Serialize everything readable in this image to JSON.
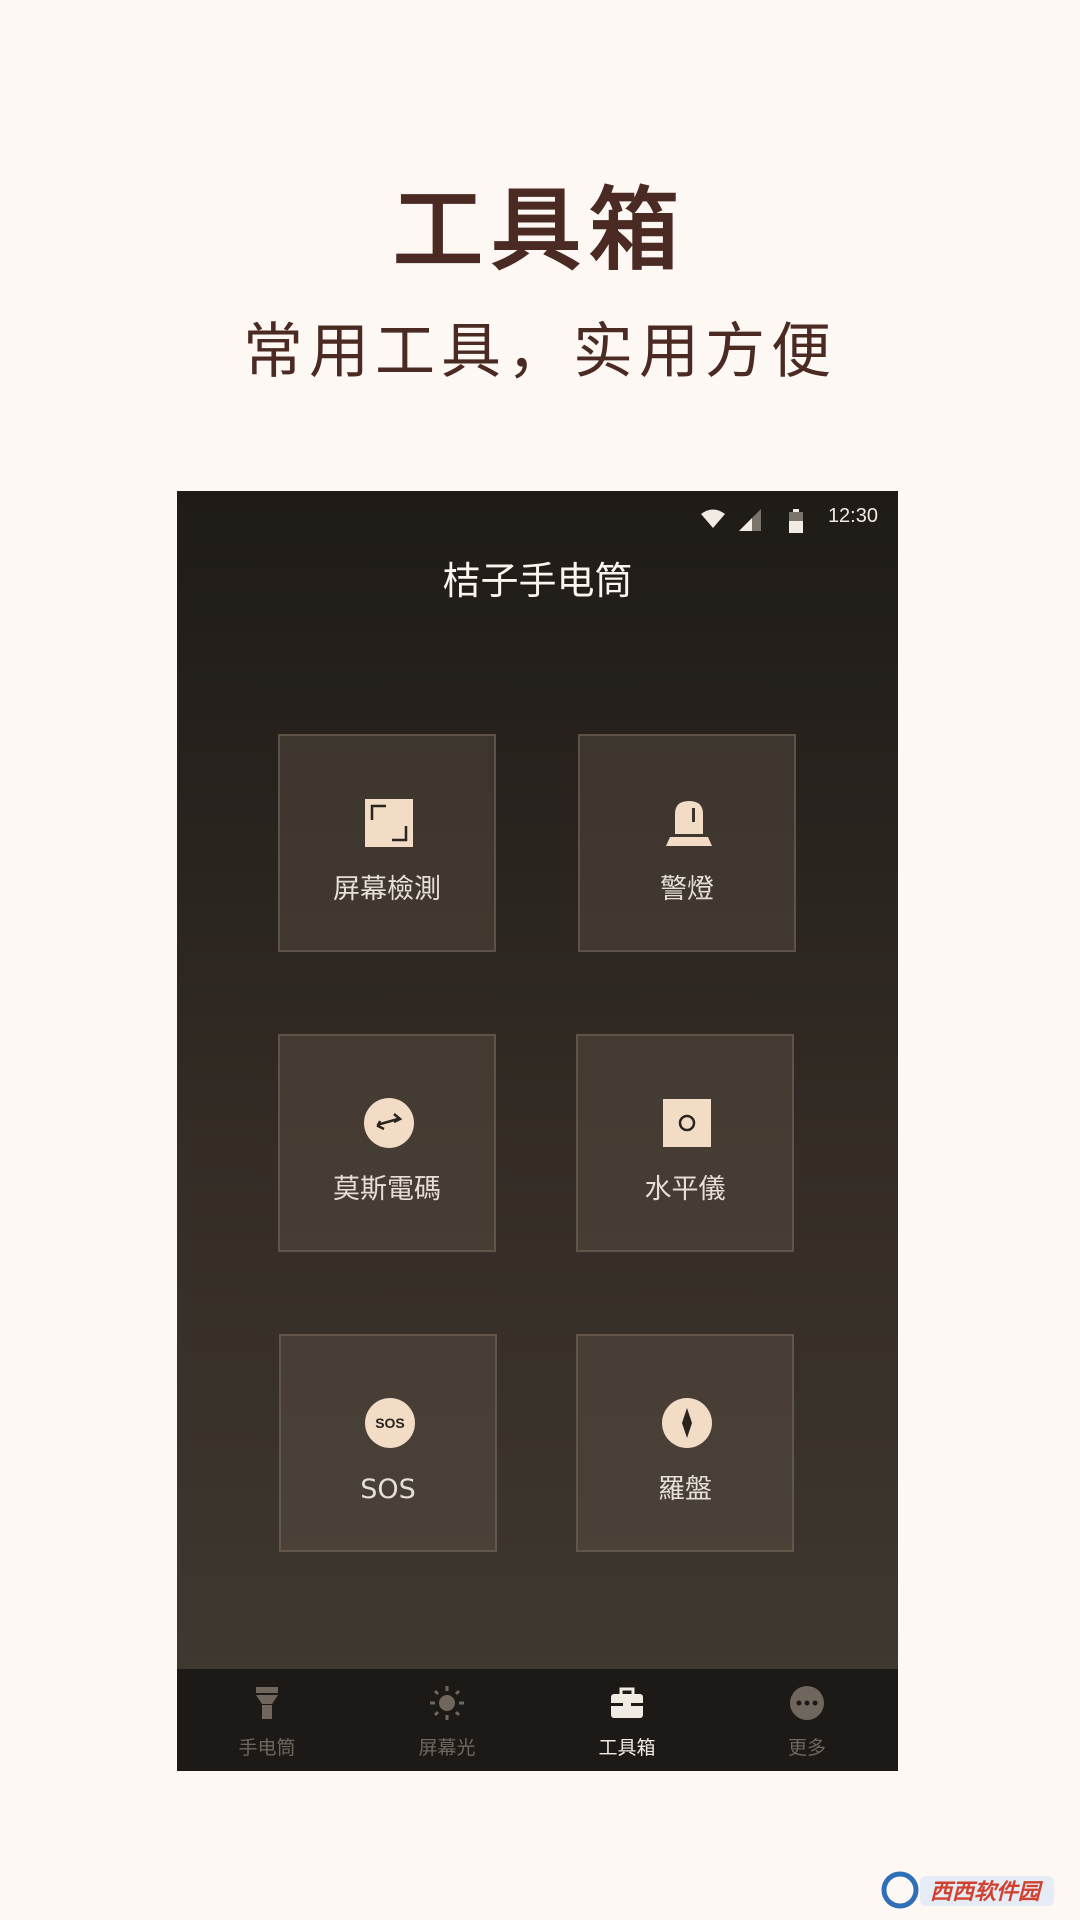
{
  "promo": {
    "title": "工具箱",
    "subtitle": "常用工具，实用方便"
  },
  "status_bar": {
    "time": "12:30",
    "icons": [
      "wifi-icon",
      "cellular-signal-icon",
      "battery-icon"
    ]
  },
  "app": {
    "title": "桔子手电筒"
  },
  "tools": [
    {
      "label": "屏幕檢測",
      "icon": "screen-test-icon"
    },
    {
      "label": "警燈",
      "icon": "warning-light-icon"
    },
    {
      "label": "莫斯電碼",
      "icon": "morse-code-icon"
    },
    {
      "label": "水平儀",
      "icon": "level-icon"
    },
    {
      "label": "SOS",
      "icon": "sos-icon",
      "icon_text": "SOS"
    },
    {
      "label": "羅盤",
      "icon": "compass-icon"
    }
  ],
  "tabs": [
    {
      "label": "手电筒",
      "icon": "flashlight-icon",
      "active": false
    },
    {
      "label": "屏幕光",
      "icon": "screen-light-icon",
      "active": false
    },
    {
      "label": "工具箱",
      "icon": "toolbox-icon",
      "active": true
    },
    {
      "label": "更多",
      "icon": "more-icon",
      "active": false
    }
  ],
  "colors": {
    "page_background": "#fdf8f3",
    "promo_text": "#4a2a22",
    "icon_cream": "#f2dcc6",
    "active_tab": "#f2ebe3",
    "inactive_tab": "#6f675e"
  }
}
